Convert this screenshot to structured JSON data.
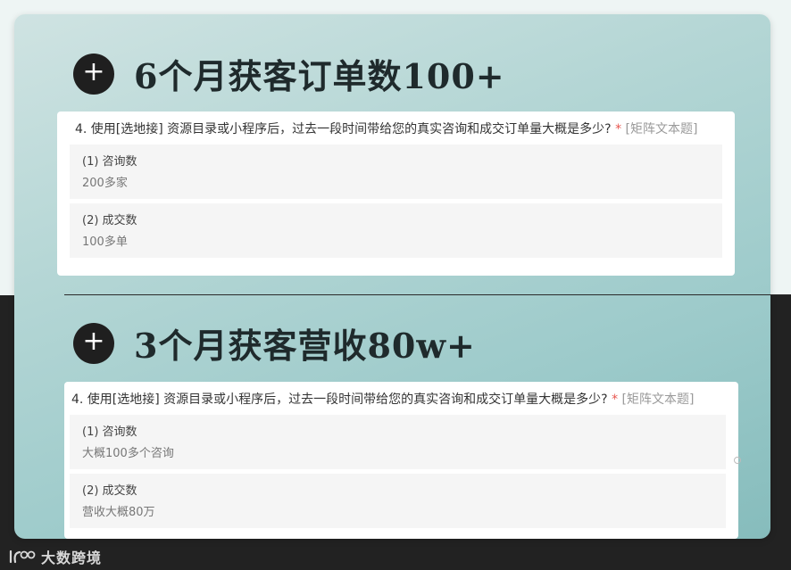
{
  "sections": [
    {
      "title": "6个月获客订单数100+",
      "question": {
        "text": "4. 使用[选地接] 资源目录或小程序后，过去一段时间带给您的真实咨询和成交订单量大概是多少?",
        "required_mark": " *",
        "type_label": " [矩阵文本题]"
      },
      "answers": [
        {
          "label": "(1) 咨询数",
          "value": "200多家"
        },
        {
          "label": "(2) 成交数",
          "value": "100多单"
        }
      ]
    },
    {
      "title": "3个月获客营收80w+",
      "question": {
        "text": "4. 使用[选地接] 资源目录或小程序后，过去一段时间带给您的真实咨询和成交订单量大概是多少?",
        "required_mark": " *",
        "type_label": " [矩阵文本题]"
      },
      "answers": [
        {
          "label": "(1) 咨询数",
          "value": "大概100多个咨询"
        },
        {
          "label": "(2) 成交数",
          "value": "营收大概80万"
        }
      ]
    }
  ],
  "watermark": {
    "text": "大数跨境"
  },
  "icons": {
    "plus": "plus-circle-icon",
    "logo": "brand-logo-icon"
  },
  "colors": {
    "required": "#e8554e",
    "card_gradient_start": "#cfe3e2",
    "card_gradient_end": "#86bcbc",
    "dark_bg": "#222222"
  }
}
